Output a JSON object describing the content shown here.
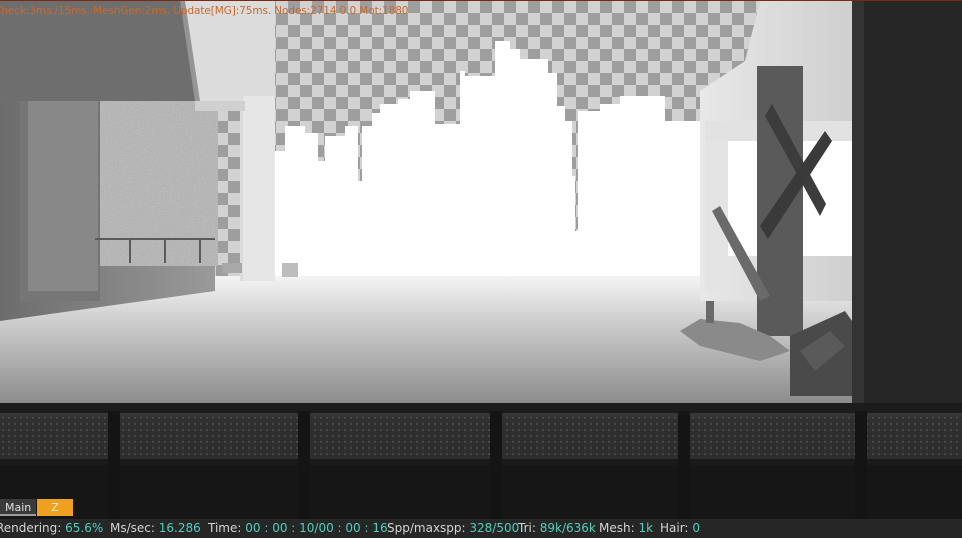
{
  "debug_overlay": "Check:3ms./15ms. MeshGen:2ms. Update[MG]:75ms. Nodes:2714  0.0 Mot:1880",
  "tabs": [
    {
      "label": "Main",
      "active": false
    },
    {
      "label": "Z",
      "active": true
    }
  ],
  "status": {
    "rendering_label": "Rendering:",
    "rendering_value": "65.6%",
    "ms_label": "Ms/sec:",
    "ms_value": "16.286",
    "time_label": "Time:",
    "time_value": "00 : 00 : 10/00 : 00 : 16",
    "spp_label": "Spp/maxspp:",
    "spp_value": "328/500",
    "tri_label": "Tri:",
    "tri_value": "89k/636k",
    "mesh_label": "Mesh:",
    "mesh_value": "1k",
    "hair_label": "Hair:",
    "hair_value": "0"
  },
  "colors": {
    "status_value": "#4fd0b8",
    "overlay_text": "#c86a2c",
    "active_tab": "#f0a020"
  }
}
